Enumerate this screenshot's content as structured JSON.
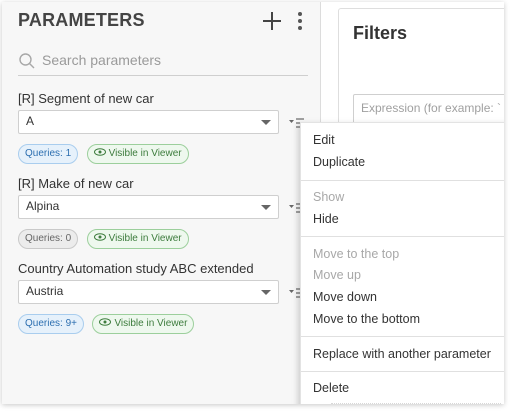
{
  "params_panel": {
    "title": "PARAMETERS",
    "search_placeholder": "Search parameters",
    "items": [
      {
        "label": "[R] Segment of new car",
        "value": "A",
        "queries": "Queries: 1",
        "visibility": "Visible in Viewer"
      },
      {
        "label": "[R] Make of new car",
        "value": "Alpina",
        "queries": "Queries: 0",
        "visibility": "Visible in Viewer"
      },
      {
        "label": "Country Automation study ABC extended",
        "value": "Austria",
        "queries": "Queries: 9+",
        "visibility": "Visible in Viewer"
      }
    ]
  },
  "filters_panel": {
    "title": "Filters",
    "expression_placeholder": "Expression (for example: `"
  },
  "context_menu": {
    "edit": "Edit",
    "duplicate": "Duplicate",
    "show": "Show",
    "hide": "Hide",
    "move_top": "Move to the top",
    "move_up": "Move up",
    "move_down": "Move down",
    "move_bottom": "Move to the bottom",
    "replace": "Replace with another parameter",
    "delete": "Delete"
  },
  "colors": {
    "panel_bg": "#f7f7f7",
    "queries_badge_blue": "#2d6fb0",
    "queries_badge_grey": "#666666",
    "visible_badge_green": "#3d7c3d"
  }
}
